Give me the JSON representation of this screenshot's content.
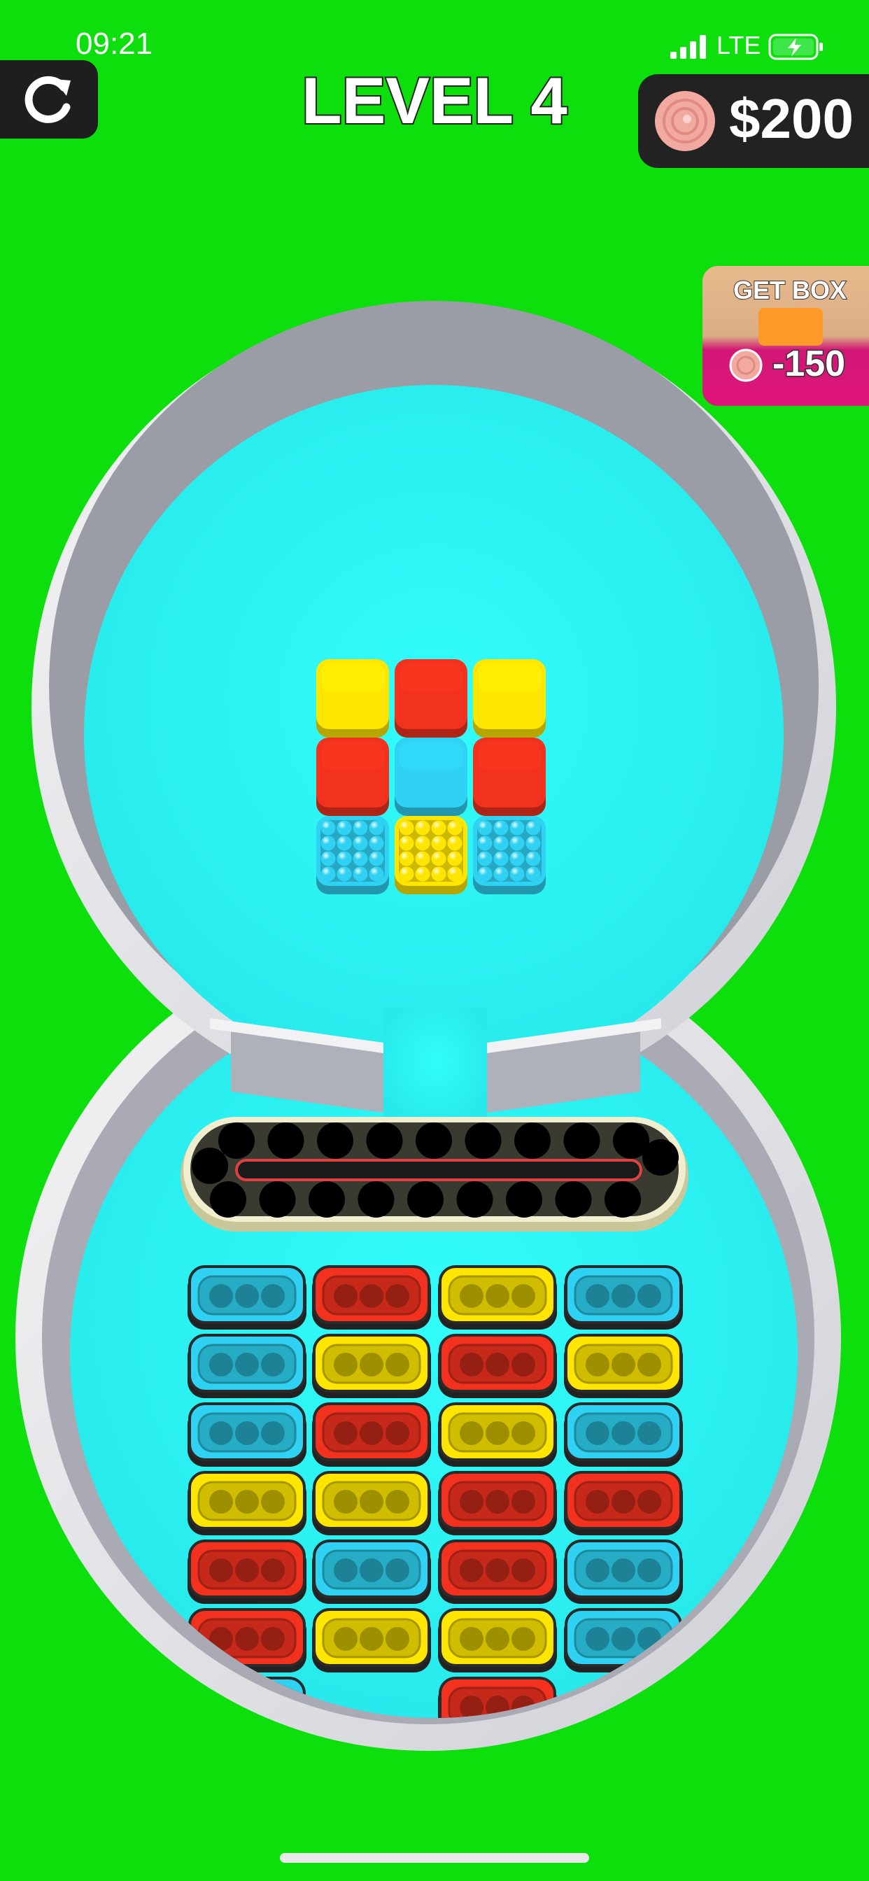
{
  "status_bar": {
    "time": "09:21",
    "network": "LTE"
  },
  "header": {
    "level_title": "LEVEL 4",
    "coins": "$200"
  },
  "get_box": {
    "title": "GET BOX",
    "cost": "-150",
    "swatch_color": "#ff9a2a"
  },
  "colors": {
    "yellow": "#ffe600",
    "red": "#f2321e",
    "blue": "#2fd2f2",
    "background": "#0ddf0d",
    "arena_floor": "#2ff6f4"
  },
  "puzzle_grid": [
    [
      {
        "color": "yellow",
        "type": "solid"
      },
      {
        "color": "red",
        "type": "solid"
      },
      {
        "color": "yellow",
        "type": "solid"
      }
    ],
    [
      {
        "color": "red",
        "type": "solid"
      },
      {
        "color": "blue",
        "type": "solid"
      },
      {
        "color": "red",
        "type": "solid"
      }
    ],
    [
      {
        "color": "blue",
        "type": "balls"
      },
      {
        "color": "yellow",
        "type": "balls"
      },
      {
        "color": "blue",
        "type": "balls"
      }
    ]
  ],
  "conveyor": {
    "slots": 20,
    "filled": 0
  },
  "capsule_rows": [
    [
      "blue",
      "red",
      "yellow",
      "blue"
    ],
    [
      "blue",
      "yellow",
      "red",
      "yellow"
    ],
    [
      "blue",
      "red",
      "yellow",
      "blue"
    ],
    [
      "yellow",
      "yellow",
      "red",
      "red"
    ],
    [
      "red",
      "blue",
      "red",
      "blue"
    ],
    [
      "red",
      "yellow",
      "yellow",
      "blue"
    ],
    [
      "blue",
      "",
      "red",
      ""
    ]
  ]
}
